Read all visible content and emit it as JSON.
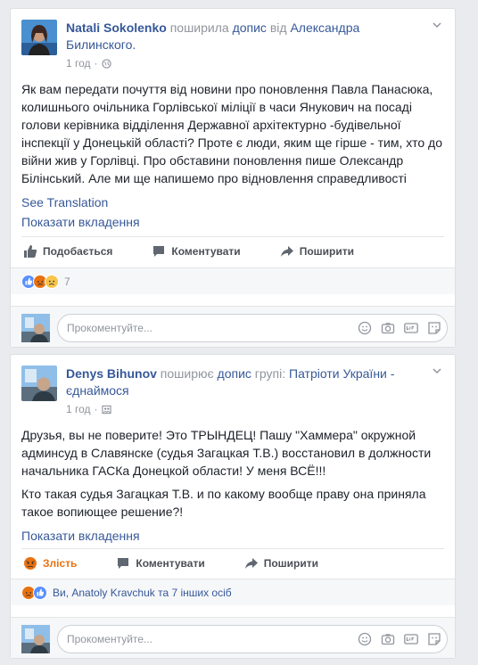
{
  "post1": {
    "author": "Natali Sokolenko",
    "action_text": " поширила ",
    "link_dopis": "допис",
    "from_text": " від ",
    "source": "Александра Билинского.",
    "time": "1 год",
    "body": "Як вам передати почуття від новини про поновлення Павла Панасюка, колишнього очільника Горлівської міліції в часи Янукович на посаді голови керівника відділення Державної архітектурно -будівельної інспекції у Донецькій області? Проте є люди, яким ще гірше - тим, хто до війни жив у Горлівці. Про обставини поновлення пише Олександр Білінський. Але ми ще напишемо про відновлення справедливості",
    "see_translation": "See Translation",
    "show_attachments": "Показати вкладення",
    "like": "Подобається",
    "comment": "Коментувати",
    "share": "Поширити",
    "reaction_count": "7",
    "comment_placeholder": "Прокоментуйте..."
  },
  "post2": {
    "author": "Denys Bihunov",
    "action_text": " поширює ",
    "link_dopis": "допис",
    "group_text": " групі: ",
    "source": "Патріоти України - єднаймося",
    "time": "1 год",
    "body1": "Друзья, вы не поверите! Это ТРЫНДЕЦ! Пашу \"Хаммера\" окружной админсуд в Славянске (судья Загацкая Т.В.) восстановил в должности начальника ГАСКа Донецкой области! У меня ВСЁ!!!",
    "body2": "Кто такая судья Загацкая Т.В. и по какому вообще праву она приняла такое вопиющее решение?!",
    "show_attachments": "Показати вкладення",
    "angry": "Злість",
    "comment": "Коментувати",
    "share": "Поширити",
    "reactions_text": "Ви, Anatoly Kravchuk та 7 інших осіб",
    "comment_placeholder": "Прокоментуйте..."
  },
  "colors": {
    "link": "#365899",
    "angry": "#e9710f",
    "like": "#5890ff"
  }
}
